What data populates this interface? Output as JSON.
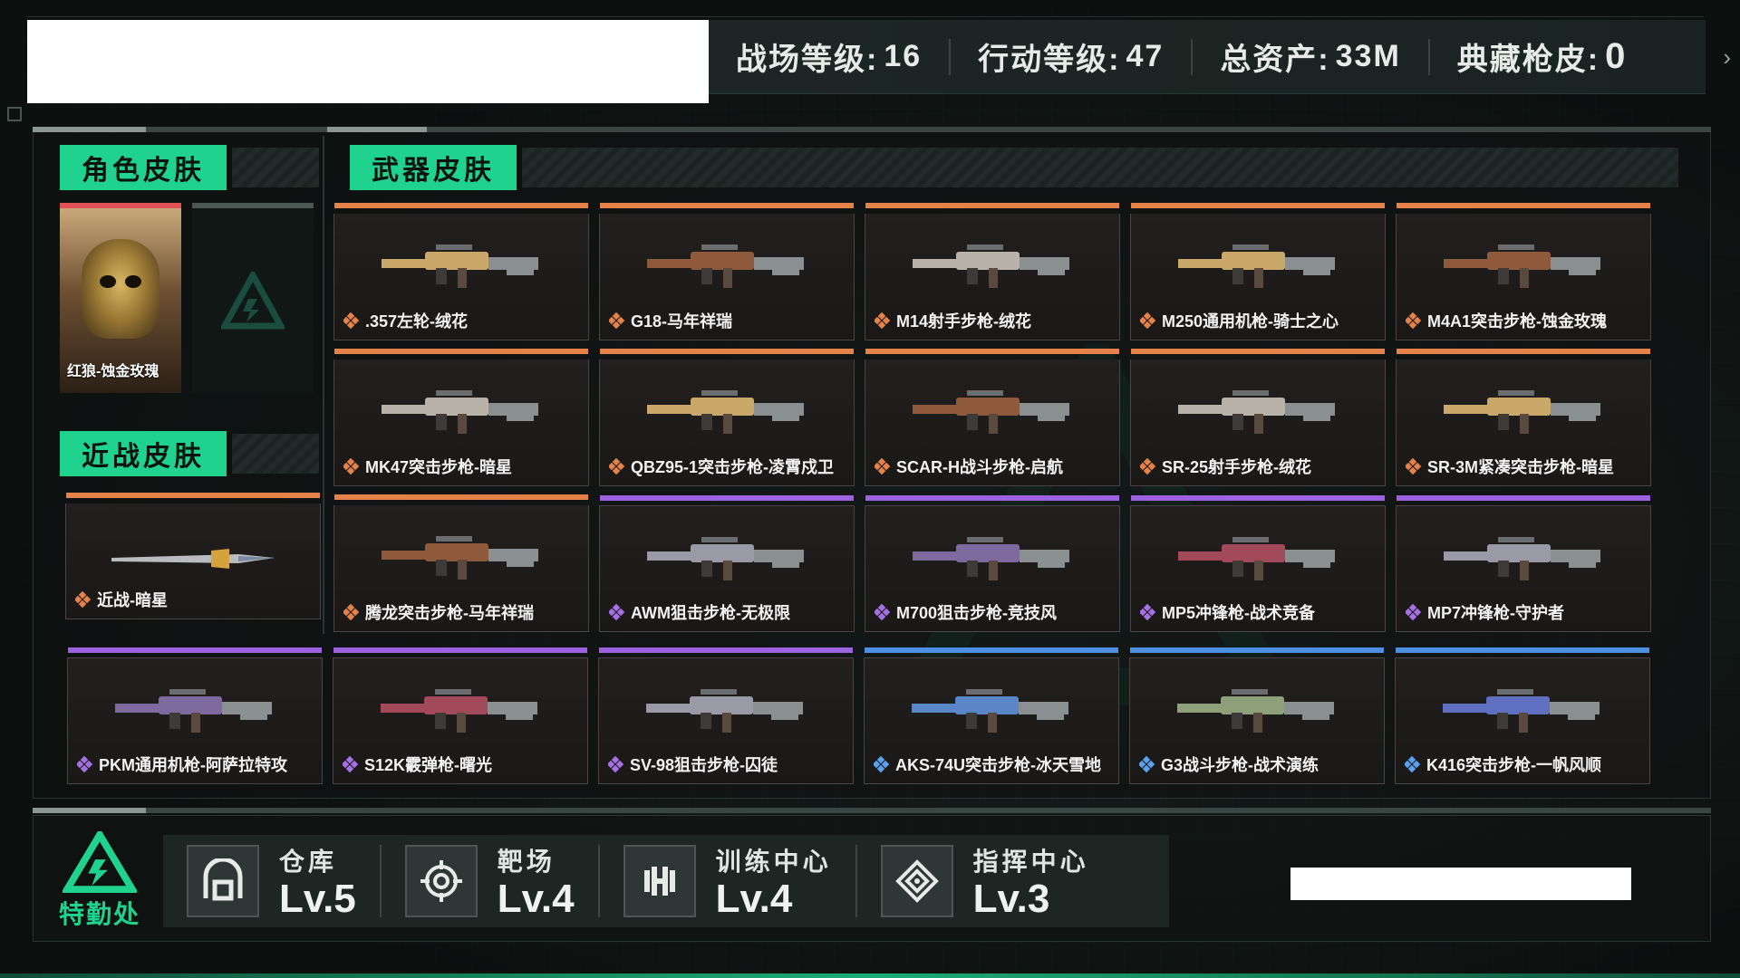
{
  "header": {
    "stats": [
      {
        "label": "战场等级:",
        "value": "16"
      },
      {
        "label": "行动等级:",
        "value": "47"
      },
      {
        "label": "总资产:",
        "value": "33M"
      },
      {
        "label": "典藏枪皮:",
        "value": "0"
      }
    ]
  },
  "sections": {
    "character": "角色皮肤",
    "melee": "近战皮肤",
    "weapon": "武器皮肤"
  },
  "character": {
    "skin_name": "红狼-蚀金玫瑰",
    "rarity_color": "#e05055"
  },
  "melee": {
    "name": "近战-暗星",
    "rarity": "orange"
  },
  "weapons": [
    {
      "name": ".357左轮-绒花",
      "rarity": "orange"
    },
    {
      "name": "G18-马年祥瑞",
      "rarity": "orange"
    },
    {
      "name": "M14射手步枪-绒花",
      "rarity": "orange"
    },
    {
      "name": "M250通用机枪-骑士之心",
      "rarity": "orange"
    },
    {
      "name": "M4A1突击步枪-蚀金玫瑰",
      "rarity": "orange"
    },
    {
      "name": "MK47突击步枪-暗星",
      "rarity": "orange"
    },
    {
      "name": "QBZ95-1突击步枪-凌霄戍卫",
      "rarity": "orange"
    },
    {
      "name": "SCAR-H战斗步枪-启航",
      "rarity": "orange"
    },
    {
      "name": "SR-25射手步枪-绒花",
      "rarity": "orange"
    },
    {
      "name": "SR-3M紧凑突击步枪-暗星",
      "rarity": "orange"
    },
    {
      "name": "腾龙突击步枪-马年祥瑞",
      "rarity": "orange"
    },
    {
      "name": "AWM狙击步枪-无极限",
      "rarity": "purple"
    },
    {
      "name": "M700狙击步枪-竞技风",
      "rarity": "purple"
    },
    {
      "name": "MP5冲锋枪-战术竞备",
      "rarity": "purple"
    },
    {
      "name": "MP7冲锋枪-守护者",
      "rarity": "purple"
    },
    {
      "name": "PKM通用机枪-阿萨拉特攻",
      "rarity": "purple"
    },
    {
      "name": "S12K霰弹枪-曙光",
      "rarity": "purple"
    },
    {
      "name": "SV-98狙击步枪-囚徒",
      "rarity": "purple"
    },
    {
      "name": "AKS-74U突击步枪-冰天雪地",
      "rarity": "blue"
    },
    {
      "name": "G3战斗步枪-战术演练",
      "rarity": "blue"
    },
    {
      "name": "K416突击步枪-一帆风顺",
      "rarity": "blue"
    }
  ],
  "rarity_colors": {
    "orange": "#e5824a",
    "purple": "#9d62e0",
    "blue": "#4d8fe0"
  },
  "accent_color": "#1fd38f",
  "footer": {
    "agency_label": "特勤处",
    "facilities": [
      {
        "name": "仓库",
        "level": "Lv.5",
        "icon": "vault-icon"
      },
      {
        "name": "靶场",
        "level": "Lv.4",
        "icon": "target-icon"
      },
      {
        "name": "训练中心",
        "level": "Lv.4",
        "icon": "dumbbell-icon"
      },
      {
        "name": "指挥中心",
        "level": "Lv.3",
        "icon": "command-emblem-icon"
      }
    ]
  }
}
